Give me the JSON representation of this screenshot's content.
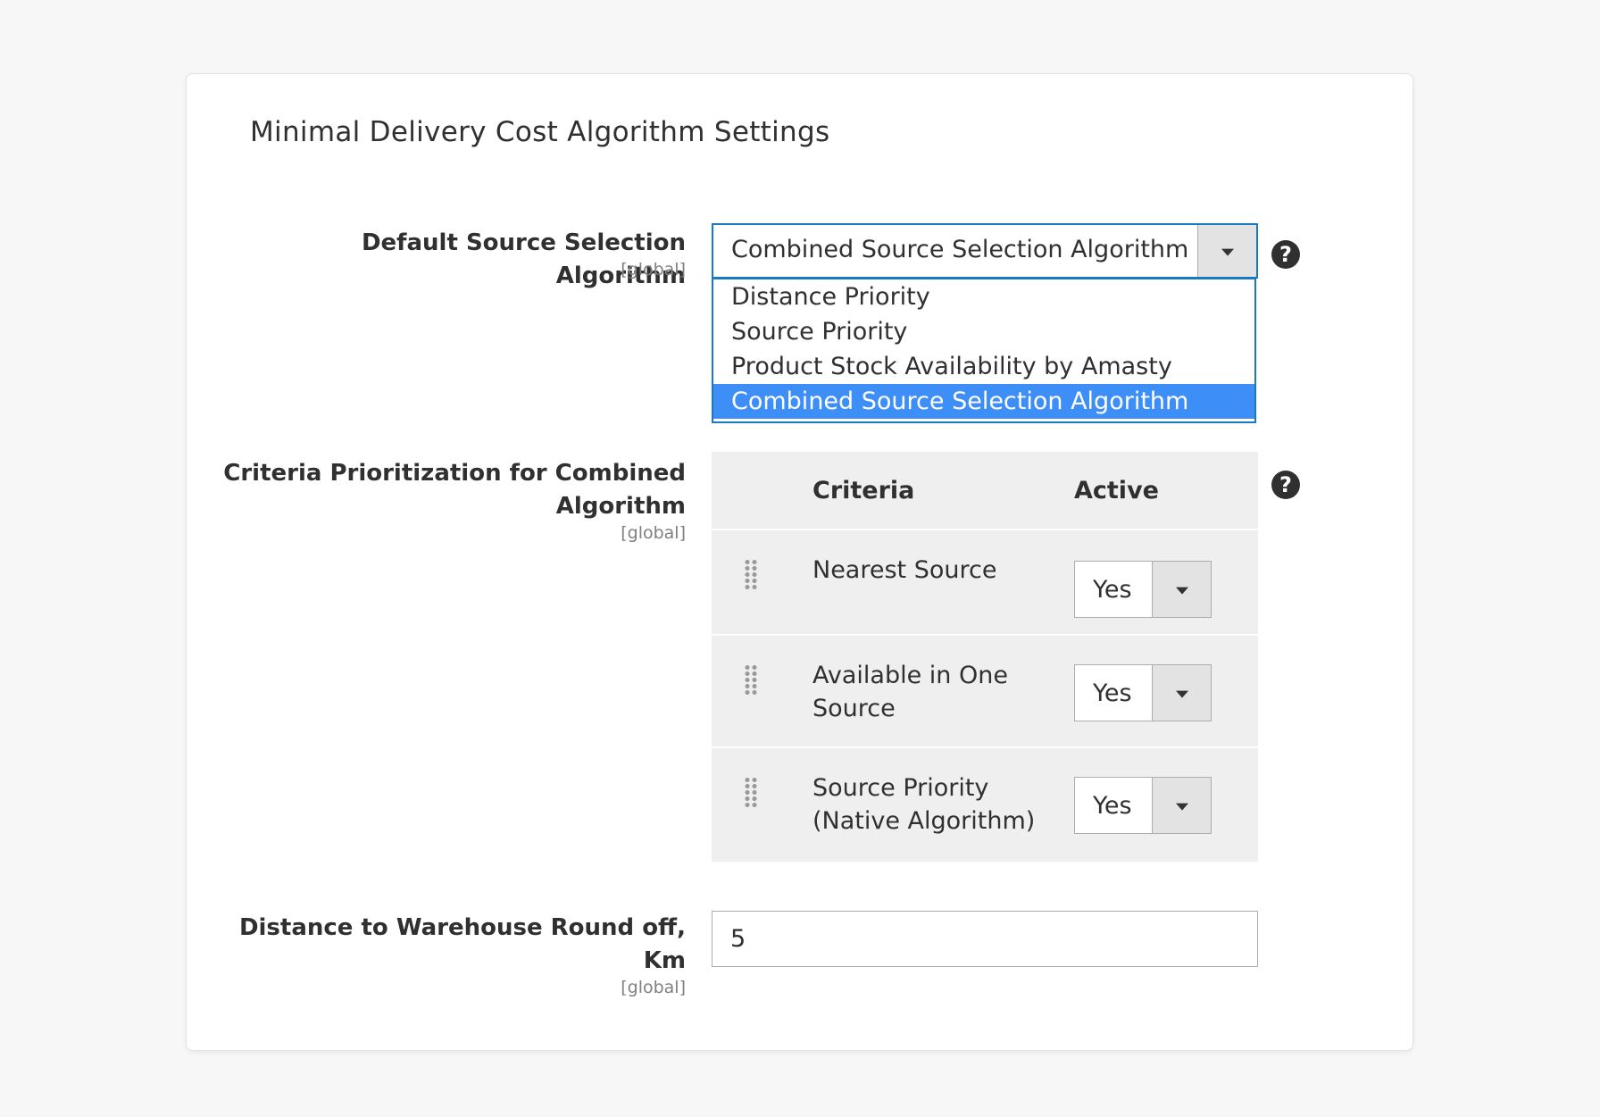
{
  "section": {
    "title": "Minimal Delivery Cost Algorithm Settings"
  },
  "default_algorithm": {
    "label": "Default Source Selection Algorithm",
    "scope": "[global]",
    "selected": "Combined Source Selection Algorithm",
    "options": [
      "Distance Priority",
      "Source Priority",
      "Product Stock Availability by Amasty",
      "Combined Source Selection Algorithm"
    ],
    "help_icon": "question-circle-icon"
  },
  "criteria": {
    "label_line1": "Criteria Prioritization for Combined",
    "label_line2": "Algorithm",
    "scope": "[global]",
    "help_icon": "question-circle-icon",
    "headers": {
      "criteria": "Criteria",
      "active": "Active"
    },
    "rows": [
      {
        "line1": "Nearest Source",
        "line2": "",
        "active": "Yes"
      },
      {
        "line1": "Available in One",
        "line2": "Source",
        "active": "Yes"
      },
      {
        "line1": "Source Priority",
        "line2": "(Native Algorithm)",
        "active": "Yes"
      }
    ]
  },
  "distance": {
    "label_line1": "Distance to Warehouse Round off,",
    "label_line2": "Km",
    "scope": "[global]",
    "value": "5"
  },
  "colors": {
    "accent": "#1979c3",
    "selected_option": "#3e8ef7",
    "table_bg": "#efefef"
  }
}
